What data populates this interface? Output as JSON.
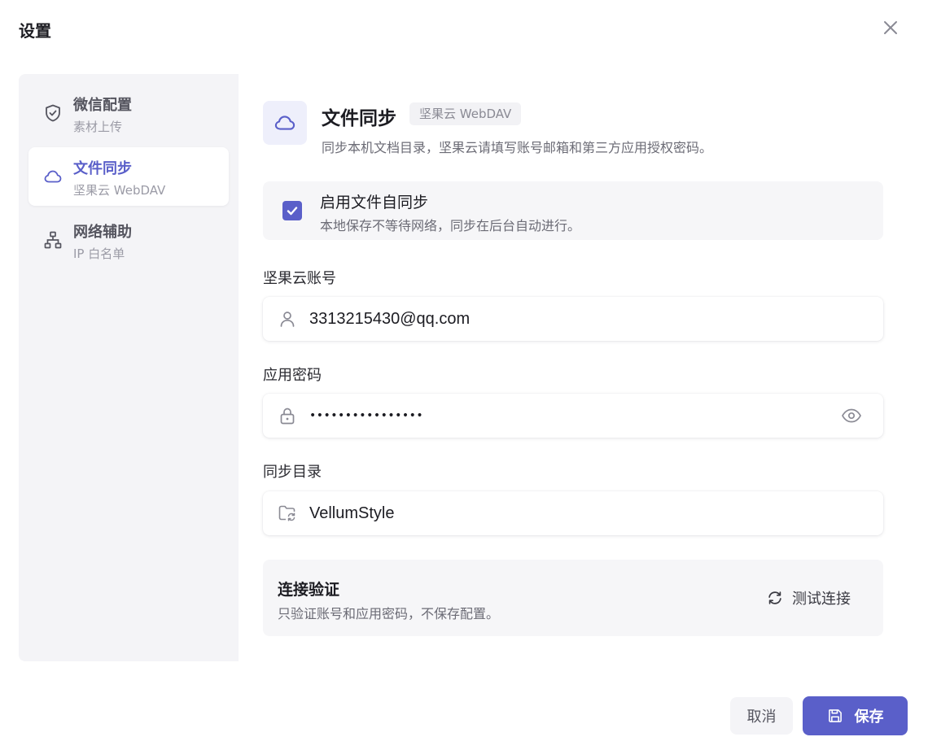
{
  "dialog": {
    "title": "设置"
  },
  "colors": {
    "accent": "#5a5fc9",
    "sidebar_bg": "#f4f4f7",
    "card_bg": "#f6f6f8"
  },
  "sidebar": {
    "items": [
      {
        "title": "微信配置",
        "subtitle": "素材上传",
        "icon": "shield-check-icon",
        "active": false
      },
      {
        "title": "文件同步",
        "subtitle": "坚果云 WebDAV",
        "icon": "cloud-icon",
        "active": true
      },
      {
        "title": "网络辅助",
        "subtitle": "IP 白名单",
        "icon": "network-icon",
        "active": false
      }
    ]
  },
  "main": {
    "header": {
      "icon": "cloud-icon",
      "title": "文件同步",
      "badge": "坚果云 WebDAV",
      "description": "同步本机文档目录，坚果云请填写账号邮箱和第三方应用授权密码。"
    },
    "sync_toggle": {
      "checked": true,
      "title": "启用文件自同步",
      "description": "本地保存不等待网络，同步在后台自动进行。"
    },
    "account": {
      "label": "坚果云账号",
      "value": "3313215430@qq.com",
      "icon": "user-icon"
    },
    "password": {
      "label": "应用密码",
      "value": "••••••••••••••••",
      "icon": "lock-icon",
      "toggle_icon": "eye-icon"
    },
    "directory": {
      "label": "同步目录",
      "value": "VellumStyle",
      "icon": "folder-sync-icon"
    },
    "verify": {
      "title": "连接验证",
      "description": "只验证账号和应用密码，不保存配置。",
      "button_label": "测试连接",
      "button_icon": "refresh-icon"
    }
  },
  "footer": {
    "cancel_label": "取消",
    "save_label": "保存",
    "save_icon": "save-icon"
  }
}
